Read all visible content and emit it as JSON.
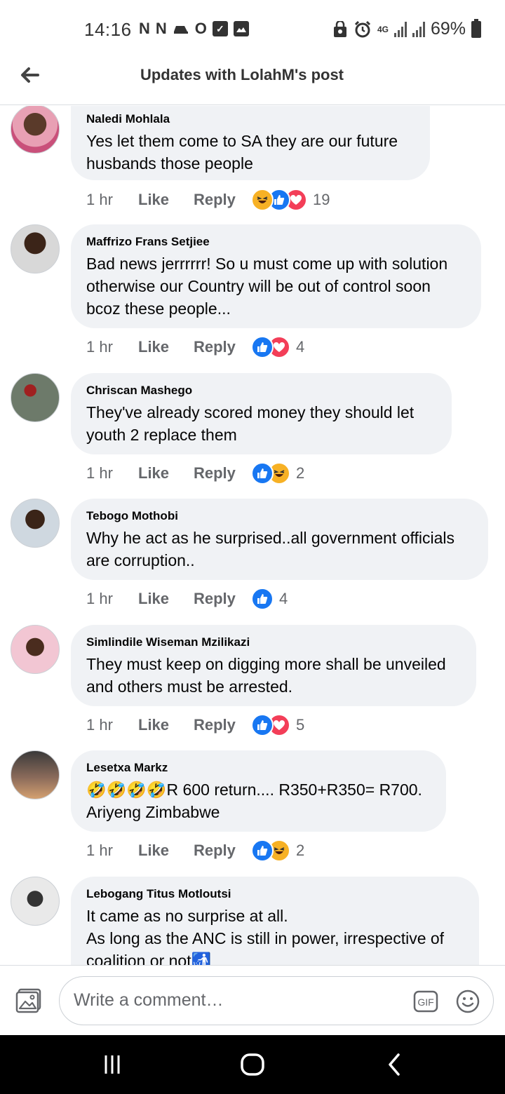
{
  "status": {
    "time": "14:16",
    "network": "4G",
    "battery": "69%"
  },
  "header": {
    "title": "Updates with LolahM's post"
  },
  "comments": [
    {
      "author": "Naledi Mohlala",
      "text": "Yes let them come to SA they are our future\nhusbands those people",
      "time": "1 hr",
      "like": "Like",
      "reply": "Reply",
      "reactions": [
        "haha",
        "like",
        "love"
      ],
      "count": "19"
    },
    {
      "author": "Maffrizo Frans Setjiee",
      "text": "Bad news jerrrrrr! So u must come up with solution\notherwise our Country will be out of control soon\nbcoz these people...",
      "time": "1 hr",
      "like": "Like",
      "reply": "Reply",
      "reactions": [
        "like",
        "love"
      ],
      "count": "4"
    },
    {
      "author": "Chriscan Mashego",
      "text": "They've already  scored money they should  let\nyouth 2 replace them",
      "time": "1 hr",
      "like": "Like",
      "reply": "Reply",
      "reactions": [
        "like",
        "haha"
      ],
      "count": "2"
    },
    {
      "author": "Tebogo Mothobi",
      "text": "Why he act as he surprised..all government officials\nare corruption..",
      "time": "1 hr",
      "like": "Like",
      "reply": "Reply",
      "reactions": [
        "like"
      ],
      "count": "4"
    },
    {
      "author": "Simlindile Wiseman Mzilikazi",
      "text": "They must keep on digging more shall be unveiled\nand others must be arrested.",
      "time": "1 hr",
      "like": "Like",
      "reply": "Reply",
      "reactions": [
        "like",
        "love"
      ],
      "count": "5"
    },
    {
      "author": "Lesetxa Markz",
      "text": "🤣🤣🤣🤣R 600 return.... R350+R350= R700.\nAriyeng Zimbabwe",
      "time": "1 hr",
      "like": "Like",
      "reply": "Reply",
      "reactions": [
        "like",
        "haha"
      ],
      "count": "2"
    },
    {
      "author": "Lebogang Titus Motloutsi",
      "text": "It came as no surprise at all.\nAs long as the ANC is still in power, irrespective of\ncoalition or not🚮",
      "time": "",
      "like": "",
      "reply": "",
      "reactions": [],
      "count": ""
    }
  ],
  "composer": {
    "placeholder": "Write a comment…",
    "gif_label": "GIF"
  },
  "colors": {
    "bubble": "#f0f2f5",
    "like_blue": "#1877f2",
    "love_red": "#f33e58",
    "haha_yellow": "#f7b125",
    "meta_gray": "#65676b"
  }
}
